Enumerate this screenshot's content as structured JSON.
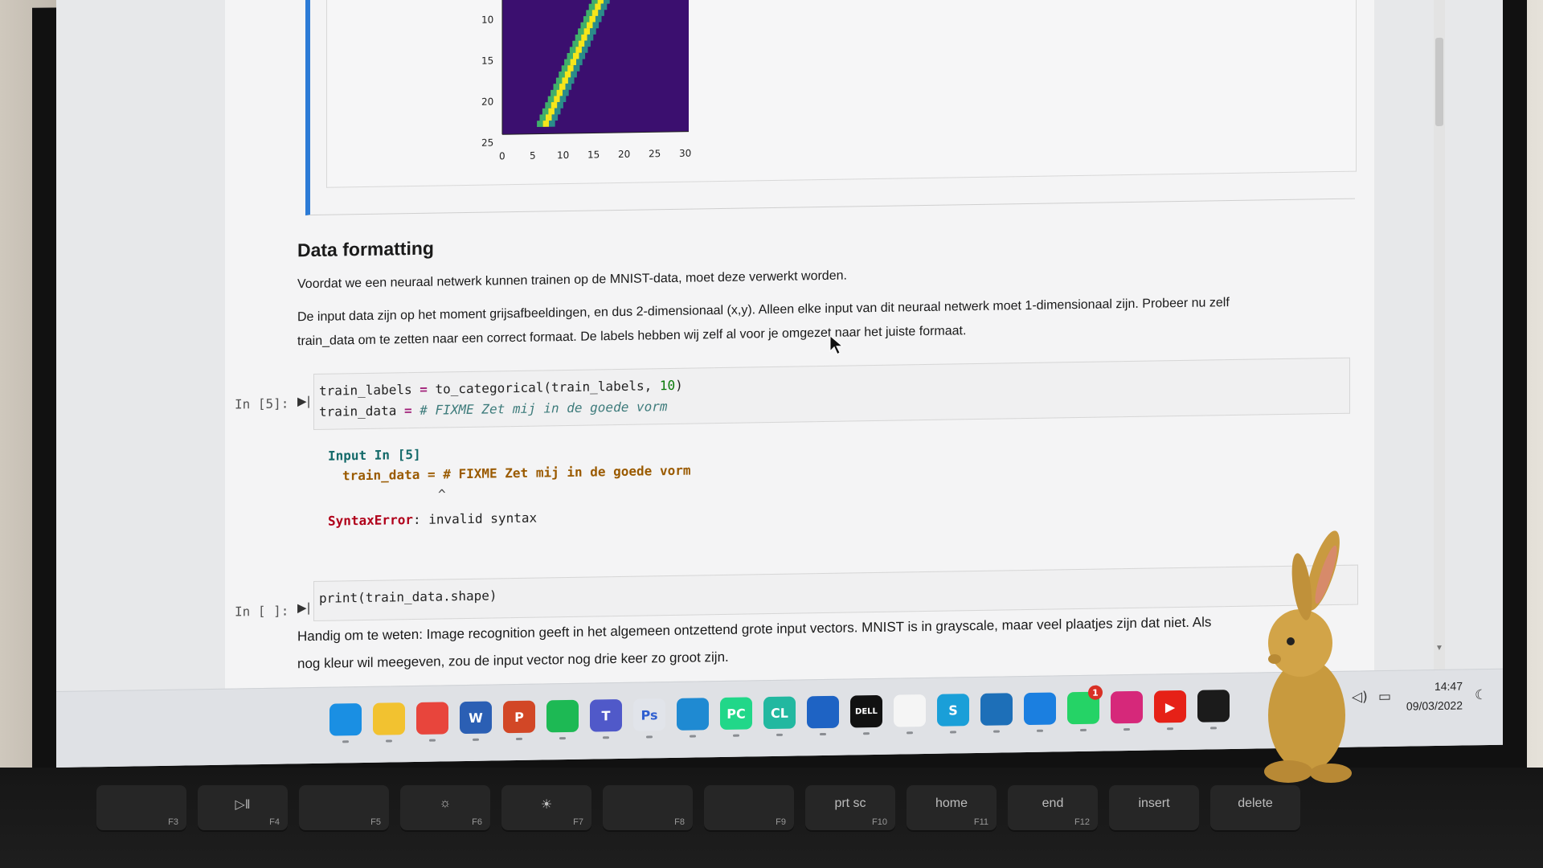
{
  "plot": {
    "y_ticks": [
      "10",
      "15",
      "20",
      "25"
    ],
    "x_ticks": [
      "0",
      "5",
      "10",
      "15",
      "20",
      "25",
      "30"
    ]
  },
  "markdown": {
    "heading": "Data formatting",
    "p1": "Voordat we een neuraal netwerk kunnen trainen op de MNIST-data, moet deze verwerkt worden.",
    "p2": "De input data zijn op het moment grijsafbeeldingen, en dus 2-dimensionaal (x,y). Alleen elke input van dit neuraal netwerk moet 1-dimensionaal zijn. Probeer nu zelf train_data om te zetten naar een correct formaat. De labels hebben wij zelf al voor je omgezet naar het juiste formaat.",
    "p3_line1": "Handig om te weten: Image recognition geeft in het algemeen ontzettend grote input vectors. MNIST is in grayscale, maar veel plaatjes zijn dat niet. Als",
    "p3_line2": "nog kleur wil meegeven, zou de input vector nog drie keer zo groot zijn."
  },
  "cell5": {
    "prompt": "In [5]:",
    "line1_a": "train_labels ",
    "line1_op": "=",
    "line1_b": " to_categorical(train_labels, ",
    "line1_num": "10",
    "line1_c": ")",
    "line2_a": "train_data ",
    "line2_op": "=",
    "line2_comment": " # FIXME Zet mij in de goede vorm",
    "out_head": "Input In [5]",
    "out_code": "train_data = # FIXME Zet mij in de goede vorm",
    "out_caret": "^",
    "err_name": "SyntaxError",
    "err_msg": ": invalid syntax"
  },
  "cell6": {
    "prompt": "In [ ]:",
    "code": "print(train_data.shape)"
  },
  "taskbar": {
    "apps": [
      {
        "name": "start",
        "label": "",
        "color": "#1a8fe3"
      },
      {
        "name": "file-explorer",
        "label": "",
        "color": "#f2c230"
      },
      {
        "name": "chrome",
        "label": "",
        "color": "#e8453c"
      },
      {
        "name": "word",
        "label": "W",
        "color": "#2b5fb4"
      },
      {
        "name": "powerpoint",
        "label": "P",
        "color": "#d24726"
      },
      {
        "name": "spotify",
        "label": "",
        "color": "#1db954"
      },
      {
        "name": "teams",
        "label": "T",
        "color": "#5059c9"
      },
      {
        "name": "photoshop",
        "label": "Ps",
        "color": "#e1e4ea"
      },
      {
        "name": "vscode",
        "label": "",
        "color": "#1f8ad2"
      },
      {
        "name": "pycharm",
        "label": "PC",
        "color": "#21d789"
      },
      {
        "name": "clion",
        "label": "CL",
        "color": "#22b8a0"
      },
      {
        "name": "app-blue-circle",
        "label": "",
        "color": "#1e63c4"
      },
      {
        "name": "dell",
        "label": "DELL",
        "color": "#111111"
      },
      {
        "name": "notepad",
        "label": "",
        "color": "#f5f5f5"
      },
      {
        "name": "app-s",
        "label": "S",
        "color": "#1a9fd8"
      },
      {
        "name": "app-books",
        "label": "",
        "color": "#1d6fb8"
      },
      {
        "name": "edge",
        "label": "",
        "color": "#1b7fe0"
      },
      {
        "name": "whatsapp",
        "label": "",
        "color": "#25d366",
        "badge": "1"
      },
      {
        "name": "instagram",
        "label": "",
        "color": "#d6287a"
      },
      {
        "name": "youtube",
        "label": "▶",
        "color": "#e62117"
      },
      {
        "name": "terminal",
        "label": "",
        "color": "#1b1b1b"
      }
    ],
    "time": "14:47",
    "date": "09/03/2022"
  },
  "keyboard": {
    "keys": [
      {
        "main": "",
        "fn": "F3"
      },
      {
        "main": "▷‖",
        "fn": "F4"
      },
      {
        "main": "",
        "fn": "F5"
      },
      {
        "main": "☼",
        "fn": "F6"
      },
      {
        "main": "☀",
        "fn": "F7"
      },
      {
        "main": "",
        "fn": "F8"
      },
      {
        "main": "",
        "fn": "F9"
      },
      {
        "main": "prt sc",
        "fn": "F10"
      },
      {
        "main": "home",
        "fn": "F11"
      },
      {
        "main": "end",
        "fn": "F12"
      },
      {
        "main": "insert",
        "fn": ""
      },
      {
        "main": "delete",
        "fn": ""
      }
    ]
  }
}
